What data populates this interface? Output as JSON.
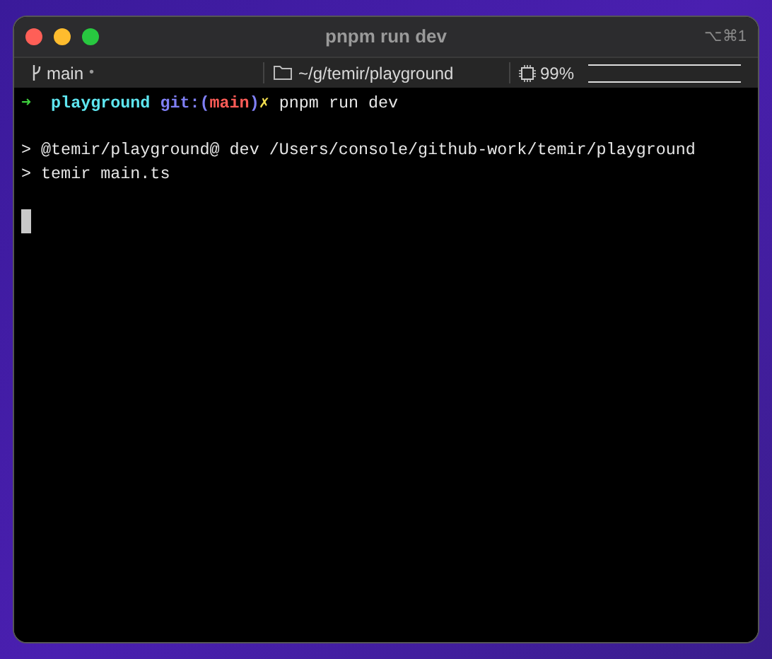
{
  "window": {
    "title": "pnpm run dev",
    "shortcut": "⌥⌘1"
  },
  "status_bar": {
    "branch": "main",
    "branch_dot": "•",
    "path": "~/g/temir/playground",
    "cpu": "99%"
  },
  "terminal": {
    "prompt": [
      {
        "kind": "arrow",
        "text": "➜"
      },
      {
        "kind": "dir",
        "text": "playground"
      },
      {
        "kind": "git",
        "text": "git:("
      },
      {
        "kind": "branch",
        "text": "main"
      },
      {
        "kind": "git",
        "text": ")"
      },
      {
        "kind": "dirty",
        "text": "✗"
      },
      {
        "kind": "command",
        "text": "pnpm run dev"
      }
    ],
    "output": [
      "> @temir/playground@ dev /Users/console/github-work/temir/playground",
      "> temir main.ts"
    ],
    "cursor": true
  }
}
